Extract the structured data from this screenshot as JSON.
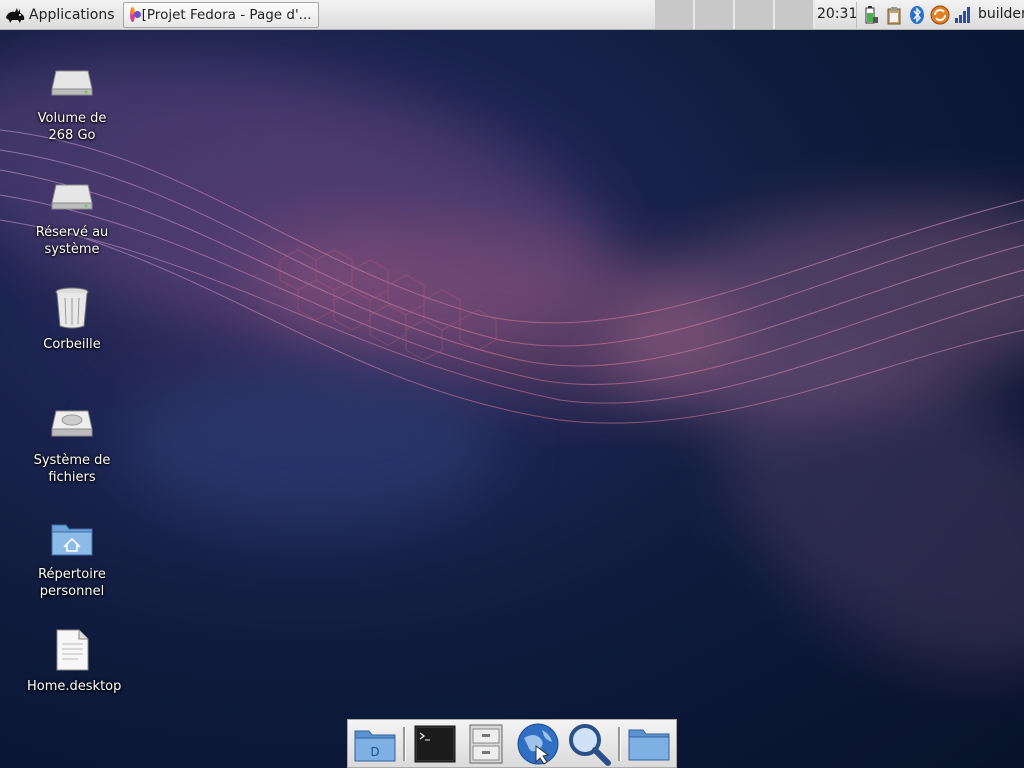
{
  "panel": {
    "applications_label": "Applications",
    "task_title": "[Projet Fedora - Page d'...",
    "clock": "20:31",
    "user": "builder"
  },
  "desktop_icons": [
    {
      "label": "Volume de 268 Go",
      "icon": "drive-icon"
    },
    {
      "label": "Réservé au système",
      "icon": "drive-icon"
    },
    {
      "label": "Corbeille",
      "icon": "trash-icon"
    },
    {
      "label": "Système de fichiers",
      "icon": "drive-icon"
    },
    {
      "label": "Répertoire personnel",
      "icon": "home-folder-icon"
    },
    {
      "label": "Home.desktop",
      "icon": "document-icon"
    }
  ],
  "dock_items": [
    "desktop-folder-icon",
    "terminal-icon",
    "file-manager-icon",
    "web-browser-icon",
    "search-icon",
    "folder-icon"
  ],
  "colors": {
    "panel_bg": "#e3e3e3",
    "accent_blue": "#3a7bd5"
  }
}
